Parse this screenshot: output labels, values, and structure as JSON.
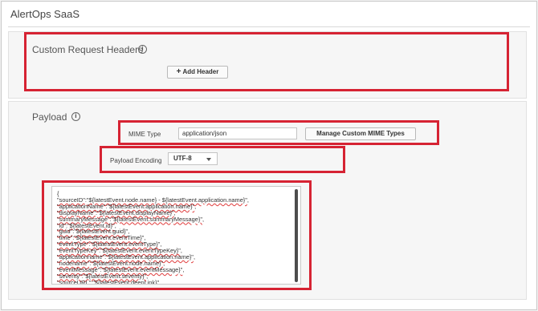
{
  "app": {
    "title": "AlertOps SaaS"
  },
  "custom_headers": {
    "title": "Custom Request Headers",
    "info_icon": "info-icon",
    "add_header_label": "Add Header",
    "add_header_icon": "plus-icon"
  },
  "payload": {
    "title": "Payload",
    "info_icon": "info-icon",
    "mime_type_label": "MIME Type",
    "mime_type_value": "application/json",
    "manage_mime_label": "Manage Custom MIME Types",
    "encoding_label": "Payload Encoding",
    "encoding_value": "UTF-8",
    "body_lines": [
      "{",
      "\"sourceID\":\"${latestEvent.node.name} - ${latestEvent.application.name}\",",
      "\"applicationName\":\"${latestEvent.application.name}\",",
      "\"displayName\":\"${latestEvent.displayName}\",",
      "\"summaryMessage\":\"${latestEvent.summaryMessage}\",",
      "\"id\":\"${latestEvent.id}\",",
      "\"guid\":\"${latestEvent.guid}\",",
      "\"time\":\"${latestEvent.eventTime}\",",
      "\"eventType\":\"${latestEvent.eventType}\",",
      "\"eventTypeKey\":\"${latestEvent.eventTypeKey}\",",
      "\"applicationname\":\"${latestEvent.application.name}\",",
      "\"nodename\":\"${latestEvent.node.name}\",",
      "\"eventMessage\":\"${latestEvent.eventMessage}\",",
      "\"severity\":\"${latestEvent.severity}\",",
      "\"sourceURL\":\"${latestEvent.deepLink}\""
    ]
  },
  "colors": {
    "highlight": "#d62333",
    "squiggle": "#e03b3b"
  }
}
